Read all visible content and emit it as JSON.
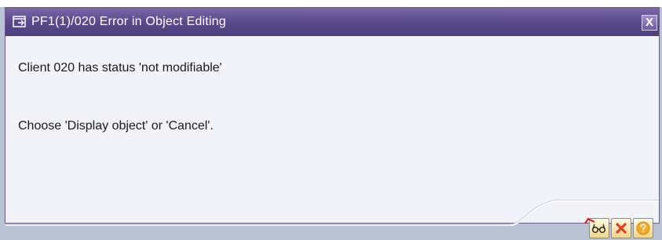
{
  "dialog": {
    "title": "PF1(1)/020 Error in Object Editing",
    "close_label": "X",
    "message_line1": "Client 020 has status 'not modifiable'",
    "message_line2": "Choose 'Display object' or 'Cancel'.",
    "buttons": [
      {
        "name": "display-object-button",
        "icon": "glasses-icon"
      },
      {
        "name": "cancel-button",
        "icon": "red-x-icon"
      },
      {
        "name": "help-button",
        "icon": "question-icon"
      }
    ]
  },
  "colors": {
    "titlebar": "#5a4a8c",
    "dialog_bg": "#f1f3f8",
    "button_bg": "#f0d48a",
    "cancel_x": "#e04020",
    "help_circle": "#f5a623"
  }
}
